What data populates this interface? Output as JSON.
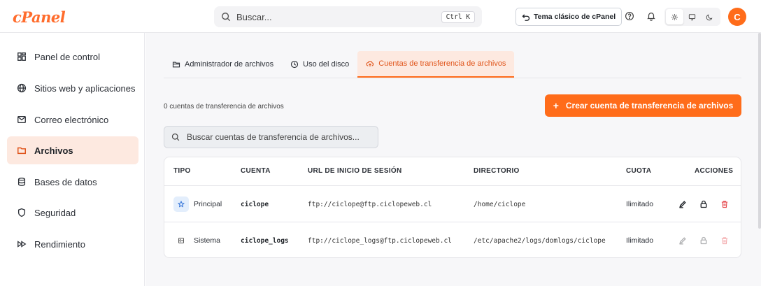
{
  "header": {
    "logo": "cPanel",
    "search_placeholder": "Buscar...",
    "search_shortcut": "Ctrl K",
    "classic_theme_label": "Tema clásico de cPanel",
    "avatar_letter": "C"
  },
  "sidebar": {
    "items": [
      {
        "label": "Panel de control",
        "icon": "dashboard-icon"
      },
      {
        "label": "Sitios web y aplicaciones",
        "icon": "globe-icon"
      },
      {
        "label": "Correo electrónico",
        "icon": "mail-icon"
      },
      {
        "label": "Archivos",
        "icon": "folder-icon",
        "active": true
      },
      {
        "label": "Bases de datos",
        "icon": "database-icon"
      },
      {
        "label": "Seguridad",
        "icon": "shield-icon"
      },
      {
        "label": "Rendimiento",
        "icon": "fast-forward-icon"
      }
    ]
  },
  "tabs": [
    {
      "label": "Administrador de archivos",
      "icon": "folder-icon"
    },
    {
      "label": "Uso del disco",
      "icon": "clock-icon"
    },
    {
      "label": "Cuentas de transferencia de archivos",
      "icon": "cloud-upload-icon",
      "active": true
    }
  ],
  "main": {
    "count_text": "0 cuentas de transferencia de archivos",
    "create_button": "Crear cuenta de transferencia de archivos",
    "create_button_plus": "+",
    "table_search_placeholder": "Buscar cuentas de transferencia de archivos..."
  },
  "table": {
    "headers": {
      "tipo": "TIPO",
      "cuenta": "CUENTA",
      "url": "URL DE INICIO DE SESIÓN",
      "directorio": "DIRECTORIO",
      "cuota": "CUOTA",
      "acciones": "ACCIONES"
    },
    "rows": [
      {
        "tipo": "Principal",
        "cuenta": "ciclope",
        "url": "ftp://ciclope@ftp.ciclopeweb.cl",
        "directorio": "/home/ciclope",
        "cuota": "Ilimitado",
        "actions_enabled": true
      },
      {
        "tipo": "Sistema",
        "cuenta": "ciclope_logs",
        "url": "ftp://ciclope_logs@ftp.ciclopeweb.cl",
        "directorio": "/etc/apache2/logs/domlogs/ciclope",
        "cuota": "Ilimitado",
        "actions_enabled": false
      }
    ]
  },
  "colors": {
    "accent": "#ff6c1a",
    "active_bg": "#fde9e0",
    "danger": "#e5484d"
  }
}
